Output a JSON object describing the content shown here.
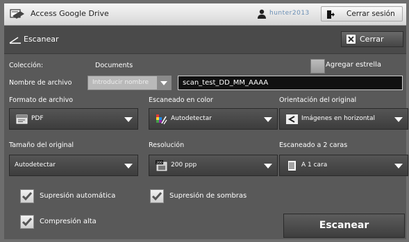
{
  "titlebar": {
    "app_title": "Access Google Drive",
    "user_name": "hunter2013",
    "logout_label": "Cerrar sesión"
  },
  "header": {
    "title": "Escanear",
    "close_label": "Cerrar"
  },
  "form": {
    "collection_label": "Colección:",
    "collection_value": "Documents",
    "star_label": "Agregar estrella",
    "filename_label": "Nombre de archivo",
    "filename_select_placeholder": "Introducir nombre",
    "filename_value": "scan_test_DD_MM_AAAA",
    "file_format": {
      "label": "Formato de archivo",
      "value": "PDF",
      "icon": "pdf-icon"
    },
    "color": {
      "label": "Escaneado en color",
      "value": "Autodetectar",
      "icon": "color-auto-icon"
    },
    "orientation": {
      "label": "Orientación del original",
      "value": "Imágenes en horizontal",
      "icon": "orientation-icon"
    },
    "size": {
      "label": "Tamaño del original",
      "value": "Autodetectar"
    },
    "resolution": {
      "label": "Resolución",
      "value": "200 ppp",
      "icon": "resolution-icon",
      "icon_text": "200"
    },
    "duplex": {
      "label": "Escaneado a 2 caras",
      "value": "A 1 cara",
      "icon": "one-sided-icon"
    },
    "auto_suppression": {
      "label": "Supresión automática",
      "checked": true
    },
    "shadow_suppression": {
      "label": "Supresión de sombras",
      "checked": true
    },
    "high_compression": {
      "label": "Compresión alta",
      "checked": true
    }
  },
  "actions": {
    "scan_label": "Escanear"
  }
}
